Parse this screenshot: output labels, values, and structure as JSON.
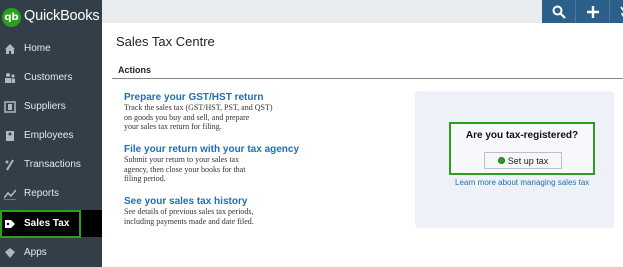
{
  "brand": {
    "logo_text": "qb",
    "name": "QuickBooks",
    "accent": "#2ca01c"
  },
  "sidebar": {
    "items": [
      {
        "label": "Home",
        "icon": "home-icon"
      },
      {
        "label": "Customers",
        "icon": "customers-icon"
      },
      {
        "label": "Suppliers",
        "icon": "suppliers-icon"
      },
      {
        "label": "Employees",
        "icon": "employees-icon"
      },
      {
        "label": "Transactions",
        "icon": "transactions-icon"
      },
      {
        "label": "Reports",
        "icon": "reports-icon"
      },
      {
        "label": "Sales Tax",
        "icon": "sales-tax-icon",
        "active": true
      },
      {
        "label": "Apps",
        "icon": "apps-icon"
      }
    ]
  },
  "topbar": {
    "icons": [
      "search-icon",
      "plus-icon",
      "recent-icon"
    ]
  },
  "page": {
    "title": "Sales Tax Centre",
    "section": "Actions"
  },
  "tasks": [
    {
      "title": "Prepare your GST/HST return",
      "desc_lines": [
        "Track the sales tax (GST/HST, PST, and QST)",
        "on goods you buy and sell, and prepare",
        "your sales tax return for filing."
      ]
    },
    {
      "title": "File your return with your tax agency",
      "desc_lines": [
        "Submit your return to your sales tax",
        "agency, then close your books for that",
        "filing period."
      ]
    },
    {
      "title": "See your sales tax history",
      "desc_lines": [
        "See details of previous sales tax periods,",
        "including payments made and date filed."
      ]
    }
  ],
  "callout": {
    "question": "Are you tax-registered?",
    "button_label": "Set up tax",
    "link": "Learn more about managing sales tax"
  }
}
